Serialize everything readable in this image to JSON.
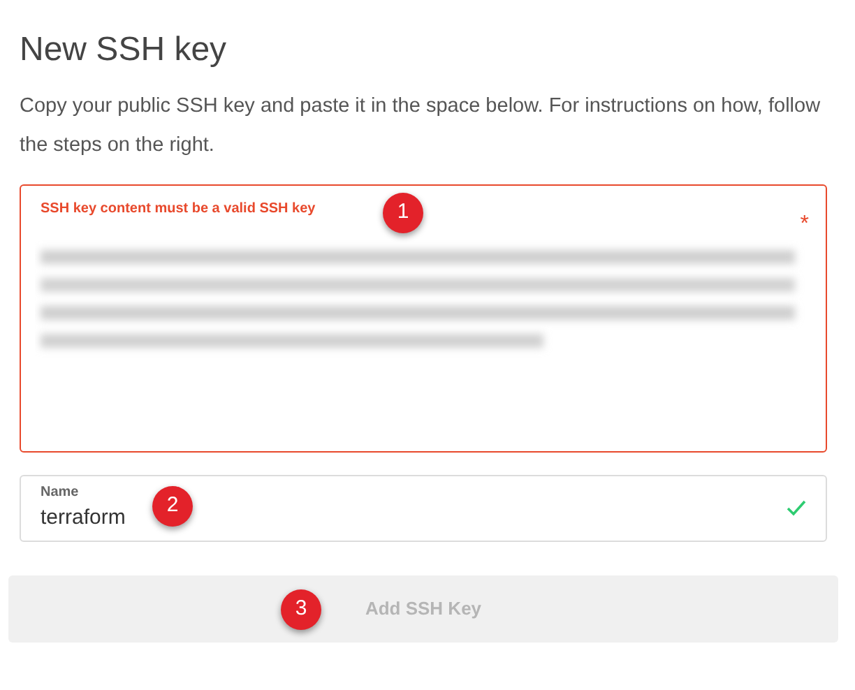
{
  "title": "New SSH key",
  "description": "Copy your public SSH key and paste it in the space below. For instructions on how, follow the steps on the right.",
  "key_field": {
    "error": "SSH key content must be a valid SSH key",
    "required_mark": "*",
    "invalid": true
  },
  "name_field": {
    "label": "Name",
    "value": "terraform",
    "valid": true
  },
  "submit_button": {
    "label": "Add SSH Key",
    "disabled": true
  },
  "markers": [
    {
      "label": "1"
    },
    {
      "label": "2"
    },
    {
      "label": "3"
    }
  ]
}
